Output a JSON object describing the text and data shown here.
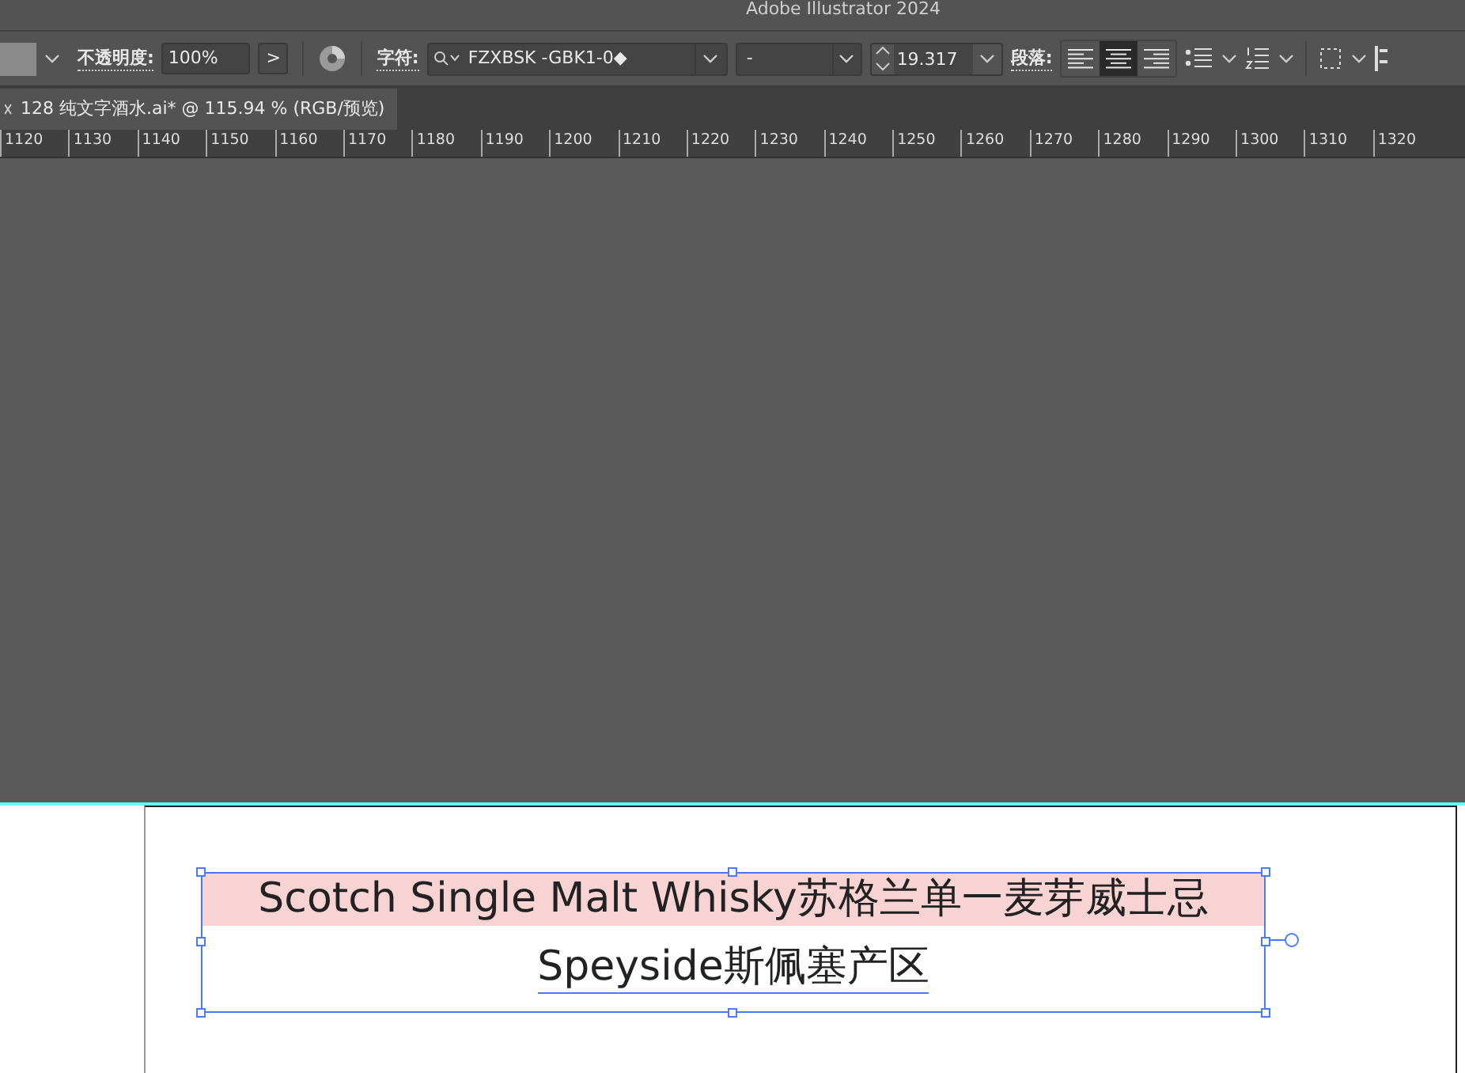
{
  "window": {
    "title": "Adobe Illustrator 2024"
  },
  "control_bar": {
    "opacity_label": "不透明度:",
    "opacity_value": "100%",
    "opacity_more": ">",
    "character_label": "字符:",
    "font_family": "FZXBSK -GBK1-0◆",
    "font_style": "-",
    "font_size": "19.317",
    "paragraph_label": "段落:",
    "align_buttons": [
      {
        "kind": "left",
        "selected": false
      },
      {
        "kind": "center",
        "selected": true
      },
      {
        "kind": "right",
        "selected": false
      }
    ]
  },
  "document_tab": {
    "title": "128 纯文字酒水.ai* @ 115.94 % (RGB/预览)",
    "selected": true
  },
  "ruler": {
    "labels": [
      "1120",
      "1130",
      "1140",
      "1150",
      "1160",
      "1170",
      "1180",
      "1190",
      "1200",
      "1210",
      "1220",
      "1230",
      "1240",
      "1250",
      "1260",
      "1270",
      "1280",
      "1290",
      "1300",
      "1310",
      "1320"
    ]
  },
  "text_frame": {
    "selected": true,
    "lines": [
      {
        "text": "Scotch Single Malt Whisky苏格兰单一麦芽威士忌",
        "highlighted": true
      },
      {
        "text": "Speyside斯佩塞产区",
        "highlighted": false
      }
    ]
  }
}
